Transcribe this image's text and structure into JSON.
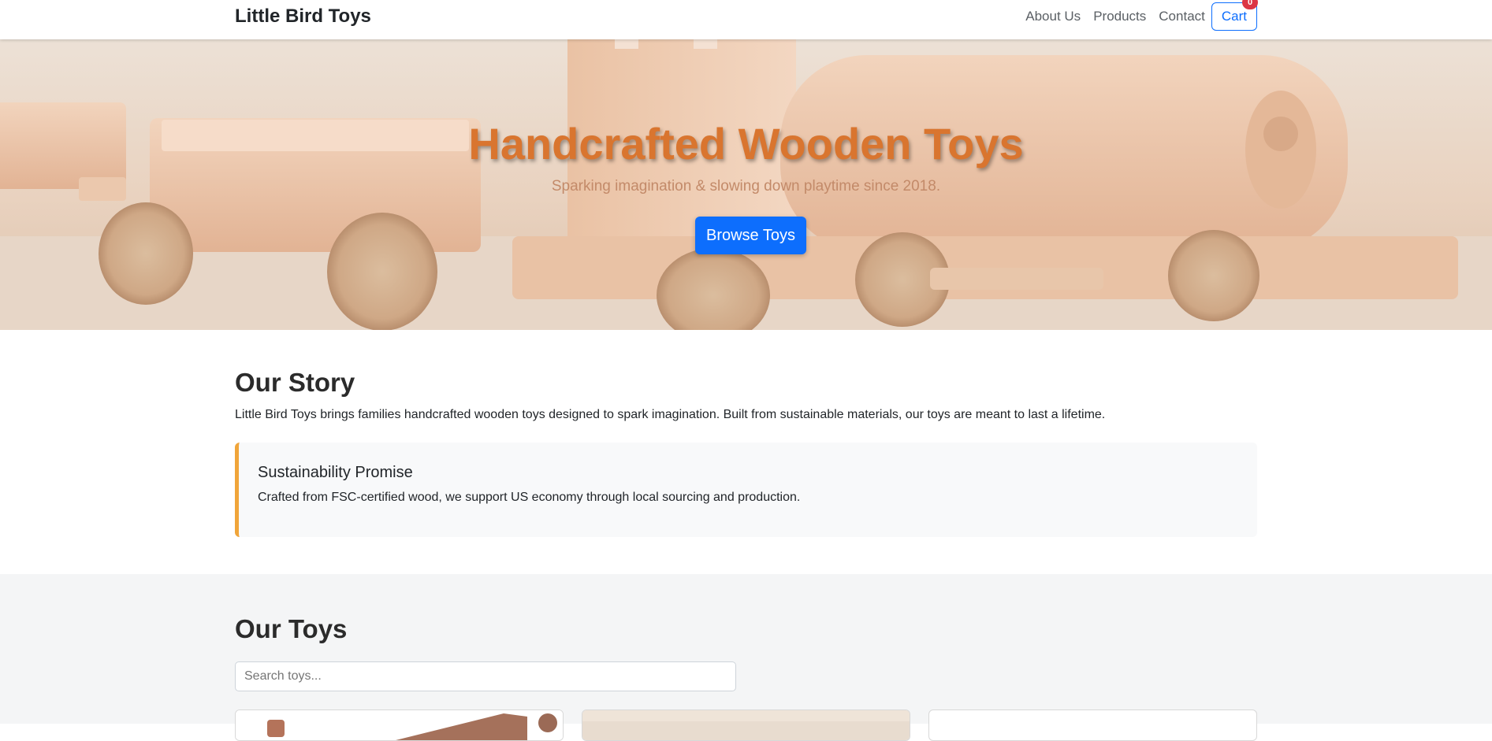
{
  "navbar": {
    "brand": "Little Bird Toys",
    "links": [
      "About Us",
      "Products",
      "Contact"
    ],
    "cart_label": "Cart",
    "cart_count": "0"
  },
  "hero": {
    "title": "Handcrafted Wooden Toys",
    "subtitle": "Sparking imagination & slowing down playtime since 2018.",
    "button": "Browse Toys"
  },
  "story": {
    "heading": "Our Story",
    "text": "Little Bird Toys brings families handcrafted wooden toys designed to spark imagination. Built from sustainable materials, our toys are meant to last a lifetime.",
    "promise_title": "Sustainability Promise",
    "promise_text": "Crafted from FSC-certified wood, we support US economy through local sourcing and production."
  },
  "toys": {
    "heading": "Our Toys",
    "search_placeholder": "Search toys..."
  },
  "colors": {
    "primary": "#0d6efd",
    "accent": "#d9752f",
    "badge": "#dc3545",
    "promise_border": "#f0a53a"
  }
}
